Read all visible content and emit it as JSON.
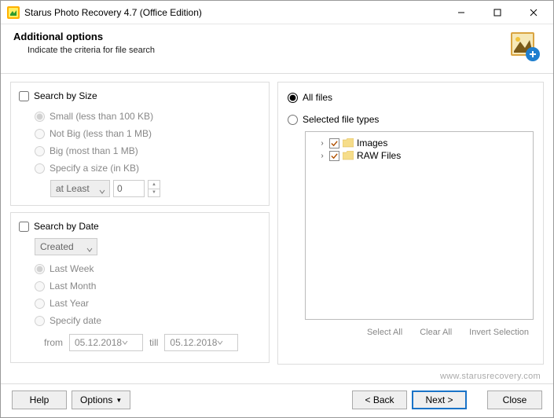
{
  "window": {
    "title": "Starus Photo Recovery 4.7 (Office Edition)"
  },
  "header": {
    "title": "Additional options",
    "subtitle": "Indicate the criteria for file search"
  },
  "size": {
    "title": "Search by Size",
    "small": "Small (less than 100 KB)",
    "notbig": "Not Big (less than 1 MB)",
    "big": "Big (most than 1 MB)",
    "specify": "Specify a size (in KB)",
    "mode": "at Least",
    "value": "0"
  },
  "date": {
    "title": "Search by Date",
    "field": "Created",
    "lastweek": "Last Week",
    "lastmonth": "Last Month",
    "lastyear": "Last Year",
    "specify": "Specify date",
    "fromlabel": "from",
    "from": "05.12.2018",
    "tilllabel": "till",
    "till": "05.12.2018"
  },
  "filetypes": {
    "all": "All files",
    "selected": "Selected file types",
    "images": "Images",
    "raw": "RAW Files",
    "selectall": "Select All",
    "clearall": "Clear All",
    "invert": "Invert Selection"
  },
  "site": "www.starusrecovery.com",
  "buttons": {
    "help": "Help",
    "options": "Options",
    "back": "< Back",
    "next": "Next >",
    "close": "Close"
  }
}
